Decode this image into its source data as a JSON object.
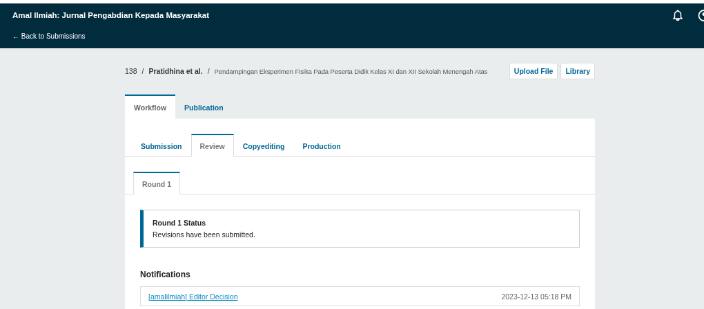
{
  "header": {
    "title": "Amal Ilmiah: Jurnal Pengabdian Kepada Masyarakat",
    "back_link": "← Back to Submissions"
  },
  "breadcrumb": {
    "id": "138",
    "authors": "Pratidhina et al.",
    "title": "Pendampingan Eksperimen Fisika Pada Peserta Didik Kelas XI dan XII Sekolah Menengah Atas",
    "separator": "/"
  },
  "actions": [
    "Upload File",
    "Library"
  ],
  "tabs": [
    {
      "label": "Workflow",
      "selected": true
    },
    {
      "label": "Publication",
      "selected": false
    }
  ],
  "stage_tabs": [
    {
      "label": "Submission",
      "selected": false
    },
    {
      "label": "Review",
      "selected": true
    },
    {
      "label": "Copyediting",
      "selected": false
    },
    {
      "label": "Production",
      "selected": false
    }
  ],
  "round_tabs": [
    {
      "label": "Round 1",
      "selected": true
    }
  ],
  "status": {
    "title": "Round 1 Status",
    "message": "Revisions have been submitted."
  },
  "notifications": {
    "heading": "Notifications",
    "items": [
      {
        "link": "[amalilmiah] Editor Decision",
        "date": "2023-12-13 05:18 PM"
      }
    ]
  }
}
